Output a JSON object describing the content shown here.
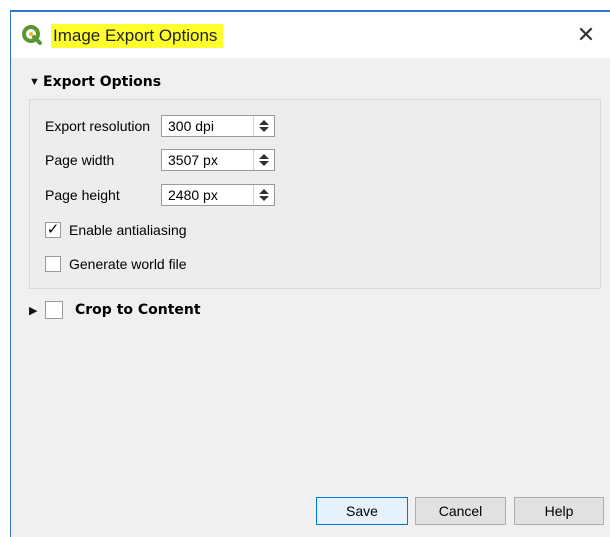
{
  "window": {
    "title": "Image Export Options",
    "close_glyph": "✕",
    "accent": "#2f74c8",
    "title_highlight": "#ffff2e"
  },
  "export_options": {
    "title": "Export Options",
    "expanded": true,
    "fields": [
      {
        "label": "Export resolution",
        "value": "300 dpi"
      },
      {
        "label": "Page width",
        "value": "3507 px"
      },
      {
        "label": "Page height",
        "value": "2480 px"
      }
    ],
    "checkboxes": [
      {
        "label": "Enable antialiasing",
        "checked": true,
        "mark": "✓"
      },
      {
        "label": "Generate world file",
        "checked": false,
        "mark": ""
      }
    ]
  },
  "crop_to_content": {
    "title": "Crop to Content",
    "expanded": false,
    "checked": false
  },
  "buttons": {
    "save": "Save",
    "cancel": "Cancel",
    "help": "Help"
  },
  "icons": {
    "app": "qgis-icon",
    "expand": "triangle-down-icon",
    "collapse": "triangle-right-icon"
  }
}
